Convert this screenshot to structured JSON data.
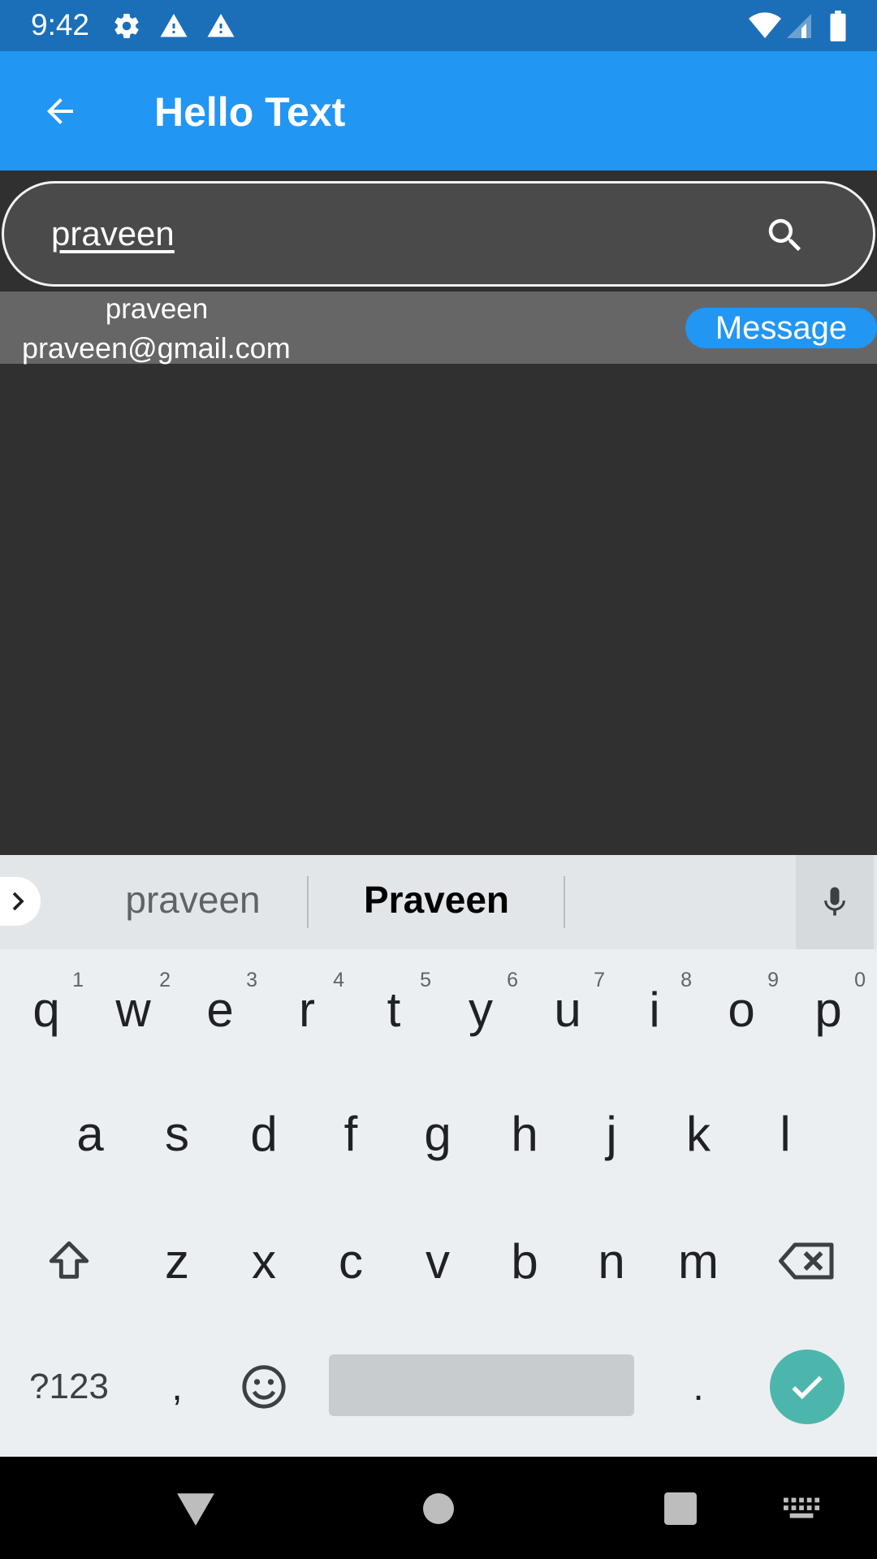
{
  "status_bar": {
    "time": "9:42",
    "icons": [
      "settings-icon",
      "warning-icon",
      "warning-icon",
      "wifi-icon",
      "signal-icon",
      "battery-icon"
    ]
  },
  "app_bar": {
    "title": "Hello Text",
    "back_icon": "arrow-back-icon"
  },
  "search": {
    "value": "praveen",
    "icon": "search-icon"
  },
  "results": [
    {
      "name": "praveen",
      "email": "praveen@gmail.com",
      "action_label": "Message"
    }
  ],
  "keyboard": {
    "suggestions": [
      "praveen",
      "Praveen"
    ],
    "row1": [
      {
        "key": "q",
        "hint": "1"
      },
      {
        "key": "w",
        "hint": "2"
      },
      {
        "key": "e",
        "hint": "3"
      },
      {
        "key": "r",
        "hint": "4"
      },
      {
        "key": "t",
        "hint": "5"
      },
      {
        "key": "y",
        "hint": "6"
      },
      {
        "key": "u",
        "hint": "7"
      },
      {
        "key": "i",
        "hint": "8"
      },
      {
        "key": "o",
        "hint": "9"
      },
      {
        "key": "p",
        "hint": "0"
      }
    ],
    "row2": [
      "a",
      "s",
      "d",
      "f",
      "g",
      "h",
      "j",
      "k",
      "l"
    ],
    "row3": [
      "z",
      "x",
      "c",
      "v",
      "b",
      "n",
      "m"
    ],
    "symbols_label": "?123",
    "comma": ",",
    "period": ".",
    "accent_color": "#4db6ac"
  },
  "colors": {
    "status_bar": "#1b6fb8",
    "app_bar": "#2196f3",
    "background": "#303030",
    "result_row": "#666666"
  }
}
